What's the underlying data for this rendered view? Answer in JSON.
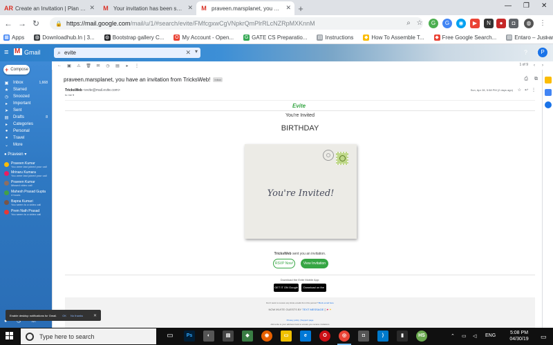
{
  "browser": {
    "tabs": [
      {
        "icon": "AR",
        "label": "Create an Invitation | Plan Your P",
        "active": false
      },
      {
        "icon": "M",
        "label": "Your invitation has been sent - p",
        "active": false
      },
      {
        "icon": "M",
        "label": "praveen.marsplanet, you have an",
        "active": true
      }
    ],
    "url_main": "https://mail.google.com",
    "url_path": "/mail/u/1/#search/evite/FMfcgxwCgVNpkrQmPlrRLcNZRpMXKnnM",
    "bookmarks": [
      {
        "label": "Apps",
        "color": "#4285f4"
      },
      {
        "label": "Downloadhub.In | 3...",
        "color": "#3c4043"
      },
      {
        "label": "Bootstrap gallery C...",
        "color": "#202124"
      },
      {
        "label": "My Account - Open...",
        "color": "#ea4335"
      },
      {
        "label": "GATE CS Preparatio...",
        "color": "#34a853"
      },
      {
        "label": "Instructions",
        "color": "#9aa0a6"
      },
      {
        "label": "How To Assemble T...",
        "color": "#fbbc04"
      },
      {
        "label": "Free Google Search...",
        "color": "#ea4335"
      },
      {
        "label": "Entaro – Just anoth...",
        "color": "#9aa0a6"
      }
    ]
  },
  "gmail": {
    "brand": "Gmail",
    "search_value": "evite",
    "compose_label": "Compose",
    "nav": [
      {
        "icon": "inbox-icon",
        "glyph": "▣",
        "label": "Inbox",
        "count": "1,668"
      },
      {
        "icon": "star-icon",
        "glyph": "★",
        "label": "Starred",
        "count": ""
      },
      {
        "icon": "clock-icon",
        "glyph": "◷",
        "label": "Snoozed",
        "count": ""
      },
      {
        "icon": "important-icon",
        "glyph": "▸",
        "label": "Important",
        "count": ""
      },
      {
        "icon": "send-icon",
        "glyph": "➤",
        "label": "Sent",
        "count": ""
      },
      {
        "icon": "draft-icon",
        "glyph": "▤",
        "label": "Drafts",
        "count": "8"
      },
      {
        "icon": "label-icon",
        "glyph": "▸",
        "label": "Categories",
        "count": ""
      },
      {
        "icon": "label-icon",
        "glyph": "●",
        "label": "Personal",
        "count": ""
      },
      {
        "icon": "label-icon",
        "glyph": "●",
        "label": "Travel",
        "count": ""
      },
      {
        "icon": "more-icon",
        "glyph": "⌄",
        "label": "More",
        "count": ""
      }
    ],
    "chat_user": "Praveen",
    "contacts": [
      {
        "name": "Praveen Kumar",
        "status": "You were last joined your call",
        "color": "#fbbc04"
      },
      {
        "name": "Mrinaru Kumara",
        "status": "You were last joined your call",
        "color": "#e91e63"
      },
      {
        "name": "Praveen Kumar",
        "status": "Missed video call",
        "color": "#8d6e63"
      },
      {
        "name": "Mahesh Prasad Gupta",
        "status": "4 hours",
        "color": "#43a047"
      },
      {
        "name": "Bapna Kumari",
        "status": "You seem to a video call",
        "color": "#795548"
      },
      {
        "name": "Prem Nath Prasad",
        "status": "You seem to a video call",
        "color": "#e53935"
      }
    ],
    "pager": "1 of 9",
    "message": {
      "subject": "praveen.marsplanet, you have an invitation from TricksWeb!",
      "tag": "Inbox",
      "sender_name": "TricksWeb",
      "sender_addr": "<evite@mail.evite.com>",
      "to": "to me",
      "date": "Sun, Apr 28, 5:58 PM (2 days ago)"
    }
  },
  "invite": {
    "brand": "Evite",
    "subtitle": "You're Invited",
    "event": "BIRTHDAY",
    "card_text": "You're Invited!",
    "host": "TricksWeb",
    "sent_text": " sent you an invitation.",
    "rsvp_label": "RSVP Now!",
    "view_label": "View Invitation",
    "app_title": "Download the Evite Mobile App:",
    "google_play": "GET IT ON Google Play",
    "app_store": "Download on the App Store",
    "footer_note": "Don't want to receive any Evite emails from this person?",
    "footer_link": "Block email here",
    "text_line_prefix": "NOW INVITE GUESTS BY",
    "text_line_link": "TEXT MESSAGE",
    "privacy": "Privacy policy | Support page",
    "small_print": "Add evite to your address book to ensure you receive invitations"
  },
  "notification": {
    "text": "Enable desktop notifications for Gmail.",
    "ok": "OK",
    "no": "No thanks"
  },
  "taskbar": {
    "search_placeholder": "Type here to search",
    "lang": "ENG",
    "time": "5:08 PM",
    "date": "04/30/19"
  }
}
